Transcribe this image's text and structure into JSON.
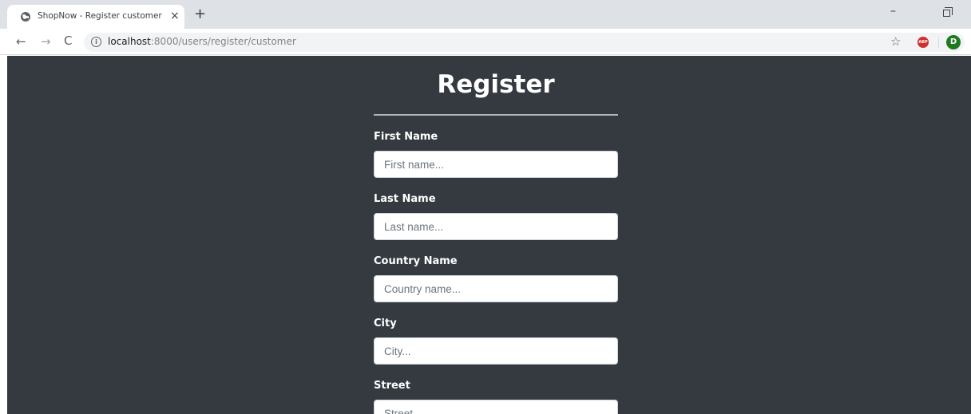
{
  "browser": {
    "tab_title": "ShopNow - Register customer",
    "tab_close": "×",
    "new_tab": "+",
    "minimize": "–",
    "url_host": "localhost",
    "url_path": ":8000/users/register/customer",
    "avatar_letter": "D",
    "abp_label": "ABP",
    "info_glyph": "i"
  },
  "form": {
    "title": "Register",
    "fields": [
      {
        "label": "First Name",
        "placeholder": "First name...",
        "value": ""
      },
      {
        "label": "Last Name",
        "placeholder": "Last name...",
        "value": ""
      },
      {
        "label": "Country Name",
        "placeholder": "Country name...",
        "value": ""
      },
      {
        "label": "City",
        "placeholder": "City...",
        "value": ""
      },
      {
        "label": "Street",
        "placeholder": "Street...",
        "value": ""
      }
    ]
  },
  "colors": {
    "page_background": "#343a40",
    "accent_avatar": "#1e7a1e",
    "abp_red": "#d32f2f"
  }
}
